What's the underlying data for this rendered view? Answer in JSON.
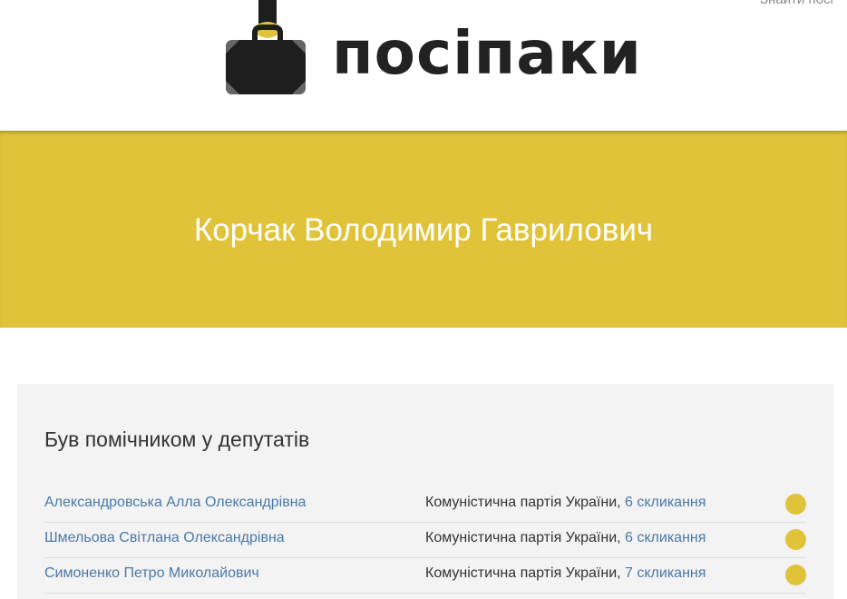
{
  "header": {
    "search_label": "Знайти посі",
    "brand": "посіпаки"
  },
  "banner": {
    "title": "Корчак Володимир Гаврилович"
  },
  "section": {
    "title": "Був помічником у депутатів",
    "rows": [
      {
        "deputy": "Александровська Алла Олександрівна",
        "party": "Комуністична партія України,",
        "convocation": "6 скликання"
      },
      {
        "deputy": "Шмельова Світлана Олександрівна",
        "party": "Комуністична партія України,",
        "convocation": "6 скликання"
      },
      {
        "deputy": "Симоненко Петро Миколайович",
        "party": "Комуністична партія України,",
        "convocation": "7 скликання"
      }
    ]
  },
  "colors": {
    "accent": "#e1c33a",
    "link": "#4a78a8",
    "text": "#333333"
  }
}
